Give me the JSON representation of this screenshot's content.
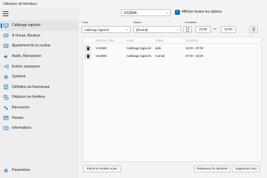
{
  "window": {
    "title": "Utilitaires de Moniteur"
  },
  "sidebar": {
    "items": [
      {
        "label": "Calibrage logiciels",
        "icon": "monitor-icon",
        "active": true
      },
      {
        "label": "À l'écran, Boutons",
        "icon": "screen-buttons-icon"
      },
      {
        "label": "Ajustement de la couleur",
        "icon": "color-adjust-icon"
      },
      {
        "label": "Audio, Microphone",
        "icon": "speaker-icon"
      },
      {
        "label": "Entrée, puissance",
        "icon": "input-power-icon"
      },
      {
        "label": "Système",
        "icon": "system-icon"
      },
      {
        "label": "Définition du fournisseur",
        "icon": "vendor-icon"
      },
      {
        "label": "Déplacer les fenêtres",
        "icon": "windows-icon"
      },
      {
        "label": "Raccourcis",
        "icon": "shortcut-icon"
      },
      {
        "label": "Horaire",
        "icon": "schedule-icon"
      },
      {
        "label": "Informations",
        "icon": "info-icon"
      }
    ],
    "settings": {
      "label": "Paramètres",
      "icon": "gear-icon"
    }
  },
  "header": {
    "monitor": "VG280K",
    "show_all_label": "Afficher toutes les options",
    "show_all_checked": true
  },
  "form": {
    "code_label": "Code",
    "code_value": "Calibrage logiciels",
    "value_label": "Valeur",
    "value_value": "[Neutral]",
    "condition_label": "Condition",
    "time_start": "10:00",
    "time_sep": "～",
    "time_end": "10:00"
  },
  "table": {
    "columns": [
      "Moniteur cible",
      "Code",
      "Valeur",
      "Condition"
    ],
    "rows": [
      {
        "monitor": "VG280K",
        "code": "Calibrage logiciels",
        "value": "dark",
        "condition": "18:00 - 07:00"
      },
      {
        "monitor": "VG280K",
        "code": "Calibrage logiciels",
        "value": "normal",
        "condition": "07:00 - 18:00"
      }
    ]
  },
  "footer": {
    "reset_label": "Réinit le rendez-vous",
    "restore_label": "Restaurez la dernière",
    "delete_all_label": "Supprimer tout"
  },
  "colors": {
    "accent": "#0067c0",
    "window_bg": "#f3f3f3",
    "sidebar_bg": "#eeeeee"
  }
}
